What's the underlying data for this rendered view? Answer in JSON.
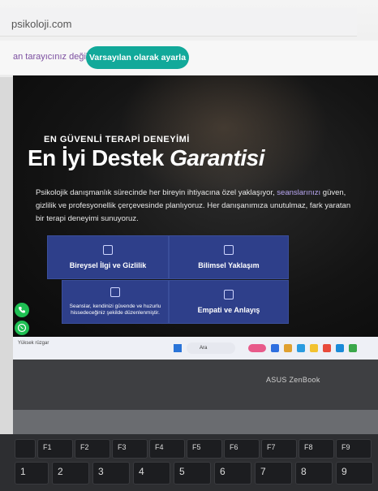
{
  "browser": {
    "url": "psikoloji.com",
    "notice_text": "an tarayıcınız değil",
    "default_button": "Varsayılan olarak ayarla"
  },
  "hero": {
    "eyebrow": "EN GÜVENLİ TERAPİ DENEYİMİ",
    "headline_main": "En İyi Destek ",
    "headline_em": "Garantisi",
    "body_pre": "Psikolojik danışmanlık sürecinde her bireyin ihtiyacına özel yaklaşıyor, ",
    "body_hl": "seanslarınızı",
    "body_mid": " güven, gizlilik ve profesyonellik çerçevesinde planlıyoruz. Her danışanımıza unutulmaz, fark yaratan bir terapi deneyimi sunuyoruz."
  },
  "features": [
    {
      "label": "Bireysel İlgi ve Gizlilik"
    },
    {
      "label": "Bilimsel Yaklaşım"
    },
    {
      "label": "Seanslar, kendinizi güvende ve huzurlu hissedeceğiniz şekilde düzenlenmiştir."
    },
    {
      "label": "Empati ve Anlayış"
    }
  ],
  "taskbar": {
    "weather": "Yüksek rüzgar",
    "search_placeholder": "Ara"
  },
  "laptop": {
    "brand": "ASUS ZenBook"
  },
  "keyboard": {
    "fn_row": [
      "F1",
      "F2",
      "F3",
      "F4",
      "F5",
      "F6",
      "F7",
      "F8",
      "F9"
    ],
    "num_row": [
      "1",
      "2",
      "3",
      "4",
      "5",
      "6",
      "7",
      "8",
      "9"
    ]
  },
  "colors": {
    "accent_teal": "#12a99a",
    "card_blue": "#2e3f8a",
    "whatsapp_green": "#1fbf53"
  }
}
